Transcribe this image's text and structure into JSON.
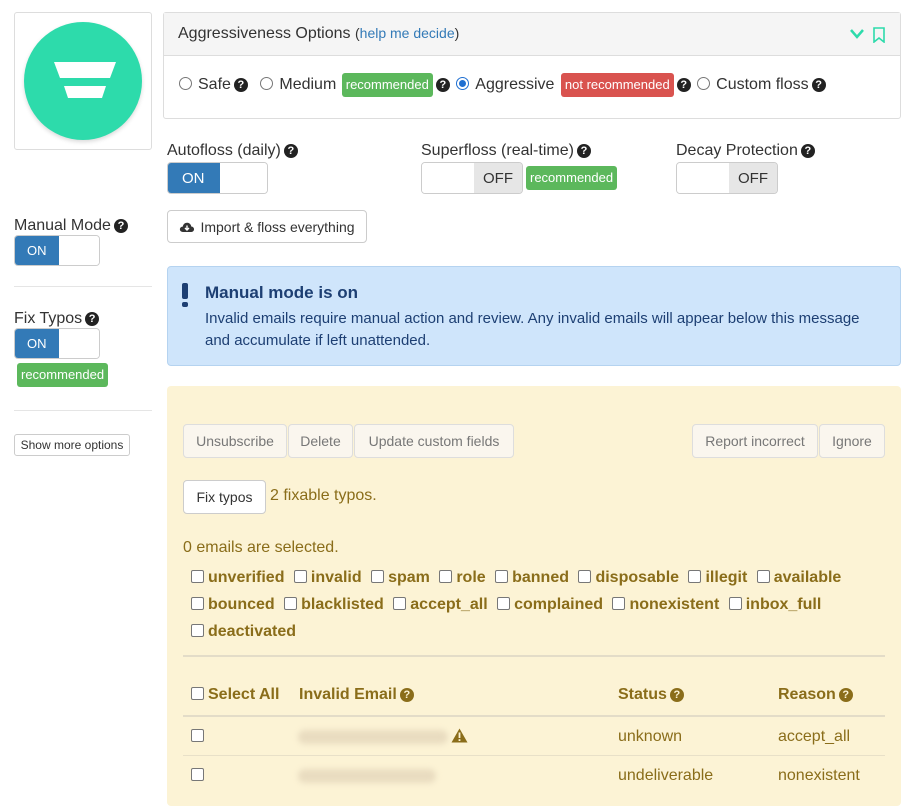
{
  "aggressiveness": {
    "title": "Aggressiveness Options",
    "help_open": "(",
    "help_link": "help me decide",
    "help_close": ")",
    "options": [
      {
        "label": "Safe",
        "checked": false
      },
      {
        "label": "Medium",
        "badge": "recommended",
        "checked": false
      },
      {
        "label": "Aggressive",
        "badge": "not recommended",
        "checked": true
      },
      {
        "label": "Custom floss",
        "checked": false
      }
    ]
  },
  "settings": {
    "autofloss": {
      "label": "Autofloss (daily)",
      "state": "ON"
    },
    "superfloss": {
      "label": "Superfloss (real-time)",
      "state": "OFF",
      "badge": "recommended"
    },
    "decay": {
      "label": "Decay Protection",
      "state": "OFF"
    },
    "import_button": "Import & floss everything"
  },
  "sidebar": {
    "manual_mode": {
      "label": "Manual Mode",
      "state": "ON"
    },
    "fix_typos": {
      "label": "Fix Typos",
      "state": "ON",
      "badge": "recommended"
    },
    "show_more": "Show more options"
  },
  "alert": {
    "title": "Manual mode is on",
    "message": "Invalid emails require manual action and review. Any invalid emails will appear below this message and accumulate if left unattended."
  },
  "actions": {
    "unsubscribe": "Unsubscribe",
    "delete": "Delete",
    "update_fields": "Update custom fields",
    "report_incorrect": "Report incorrect",
    "ignore": "Ignore",
    "fix_typos": "Fix typos",
    "fixable_count": "2 fixable typos.",
    "selected_text": "0 emails are selected."
  },
  "filters": [
    [
      "unverified",
      "invalid",
      "spam",
      "role",
      "banned",
      "disposable",
      "illegit",
      "available"
    ],
    [
      "bounced",
      "blacklisted",
      "accept_all",
      "complained",
      "nonexistent",
      "inbox_full"
    ],
    [
      "deactivated"
    ]
  ],
  "table": {
    "select_all": "Select All",
    "col_email": "Invalid Email",
    "col_status": "Status",
    "col_reason": "Reason",
    "rows": [
      {
        "status": "unknown",
        "reason": "accept_all",
        "warning": true
      },
      {
        "status": "undeliverable",
        "reason": "nonexistent",
        "warning": false
      }
    ]
  },
  "colors": {
    "accent": "#337ab7",
    "teal_logo": "#2ddbab",
    "alert_bg": "#cfe5fb",
    "panel_bg": "#fcf3d5",
    "text_olive": "#8a6d1a"
  }
}
